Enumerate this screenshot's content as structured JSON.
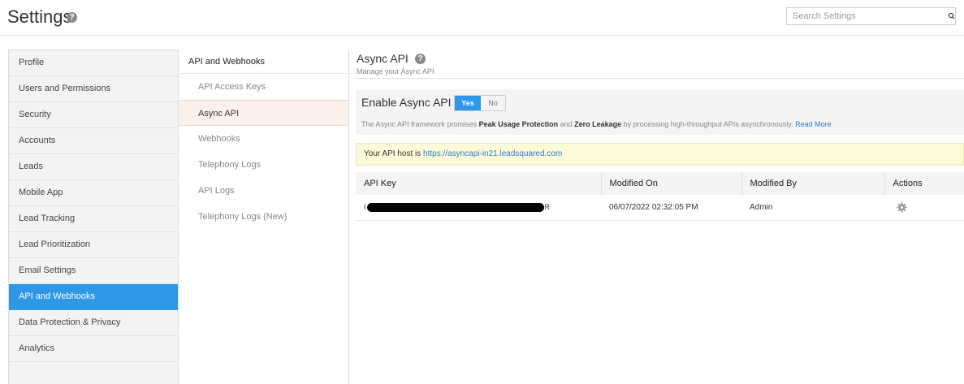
{
  "header": {
    "title": "Settings",
    "help_glyph": "?",
    "search_placeholder": "Search Settings",
    "search_value": ""
  },
  "sidebar": {
    "items": [
      {
        "label": "Profile",
        "active": false
      },
      {
        "label": "Users and Permissions",
        "active": false
      },
      {
        "label": "Security",
        "active": false
      },
      {
        "label": "Accounts",
        "active": false
      },
      {
        "label": "Leads",
        "active": false
      },
      {
        "label": "Mobile App",
        "active": false
      },
      {
        "label": "Lead Tracking",
        "active": false
      },
      {
        "label": "Lead Prioritization",
        "active": false
      },
      {
        "label": "Email Settings",
        "active": false
      },
      {
        "label": "API and Webhooks",
        "active": true
      },
      {
        "label": "Data Protection & Privacy",
        "active": false
      },
      {
        "label": "Analytics",
        "active": false
      }
    ]
  },
  "subnav": {
    "heading": "API and Webhooks",
    "items": [
      {
        "label": "API Access Keys",
        "active": false
      },
      {
        "label": "Async API",
        "active": true
      },
      {
        "label": "Webhooks",
        "active": false
      },
      {
        "label": "Telephony Logs",
        "active": false
      },
      {
        "label": "API Logs",
        "active": false
      },
      {
        "label": "Telephony Logs (New)",
        "active": false
      }
    ]
  },
  "main": {
    "title": "Async API",
    "subtitle": "Manage your Async API",
    "enable_label": "Enable Async API",
    "toggle": {
      "yes": "Yes",
      "no": "No",
      "selected": "Yes"
    },
    "description": {
      "part1": "The Async API framework promises ",
      "bold1": "Peak Usage Protection",
      "part2": " and ",
      "bold2": "Zero Leakage",
      "part3": " by processing high-throughput APIs asynchronously. ",
      "link": "Read More"
    },
    "host": {
      "prefix": "Your API host is ",
      "url": "https://asyncapi-in21.leadsquared.com"
    },
    "table": {
      "headers": [
        "API Key",
        "Modified On",
        "Modified By",
        "Actions"
      ],
      "rows": [
        {
          "key_start": "I",
          "key_end": "R",
          "modified_on": "06/07/2022 02:32:05 PM",
          "modified_by": "Admin"
        }
      ]
    }
  },
  "colors": {
    "accent": "#2e97e6",
    "link": "#2e7bcf",
    "host_bar": "#fcfad8",
    "active_subnav": "#fbf1ea"
  }
}
